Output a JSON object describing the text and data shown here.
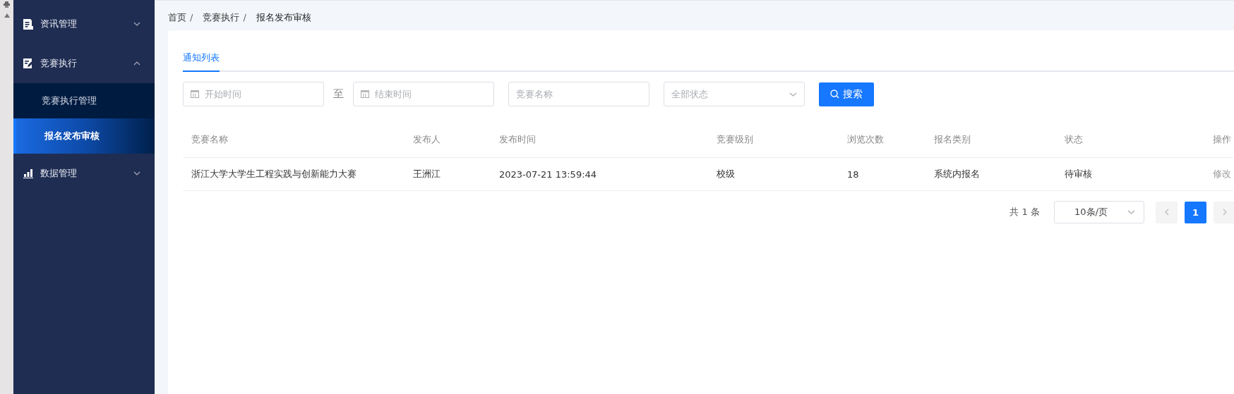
{
  "sidebar": {
    "items": [
      {
        "label": "资讯管理",
        "expanded": false
      },
      {
        "label": "竞赛执行",
        "expanded": true,
        "children": [
          {
            "label": "竞赛执行管理",
            "selected": false
          },
          {
            "label": "报名发布审核",
            "selected": true
          }
        ]
      },
      {
        "label": "数据管理",
        "expanded": false
      }
    ]
  },
  "breadcrumb": [
    {
      "label": "首页",
      "separator": "/"
    },
    {
      "label": "竞赛执行",
      "separator": "/"
    },
    {
      "label": "报名发布审核"
    }
  ],
  "tabs": [
    {
      "label": "通知列表",
      "selected": true
    }
  ],
  "filters": {
    "start_date": {
      "placeholder": "开始时间"
    },
    "range_separator": "至",
    "end_date": {
      "placeholder": "结束时间"
    },
    "name": {
      "placeholder": "竞赛名称"
    },
    "status": {
      "placeholder": "全部状态"
    },
    "search_button": "搜索"
  },
  "table": {
    "columns": [
      "竞赛名称",
      "发布人",
      "发布时间",
      "竞赛级别",
      "浏览次数",
      "报名类别",
      "状态",
      "操作"
    ],
    "rows": [
      {
        "cells": [
          "浙江大学大学生工程实践与创新能力大赛",
          "王洲江",
          "2023-07-21 13:59:44",
          "校级",
          "18",
          "系统内报名",
          "待审核"
        ],
        "action": "修改"
      }
    ]
  },
  "pagination": {
    "total": "共 1 条",
    "page_size": "10条/页",
    "pages": [
      {
        "label": "1",
        "selected": true
      }
    ]
  }
}
